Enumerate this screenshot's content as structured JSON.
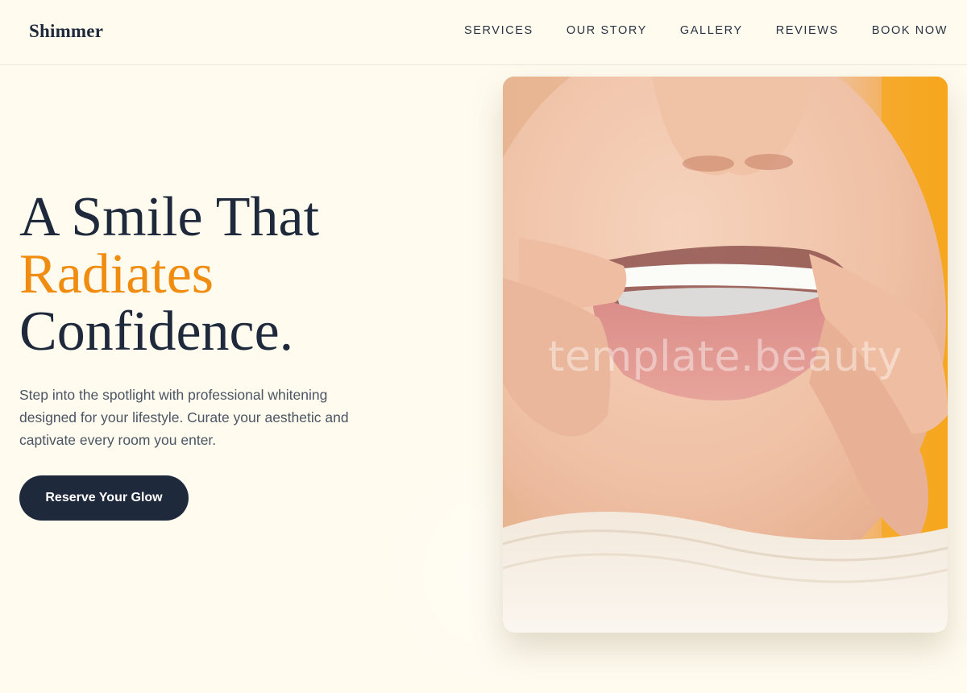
{
  "brand": {
    "name": "Shimmer"
  },
  "nav": {
    "items": [
      {
        "label": "SERVICES"
      },
      {
        "label": "OUR STORY"
      },
      {
        "label": "GALLERY"
      },
      {
        "label": "REVIEWS"
      },
      {
        "label": "BOOK NOW"
      }
    ]
  },
  "hero": {
    "title_line1": "A Smile That",
    "title_accent": "Radiates",
    "title_line3": "Confidence.",
    "description": "Step into the spotlight with professional whitening designed for your lifestyle. Curate your aesthetic and captivate every room you enter.",
    "cta_label": "Reserve Your Glow",
    "accent_color": "#f08c0f",
    "cta_color": "#1e293b"
  },
  "image": {
    "subject": "person-inserting-clear-aligner-photo",
    "watermark": "template.beauty"
  }
}
